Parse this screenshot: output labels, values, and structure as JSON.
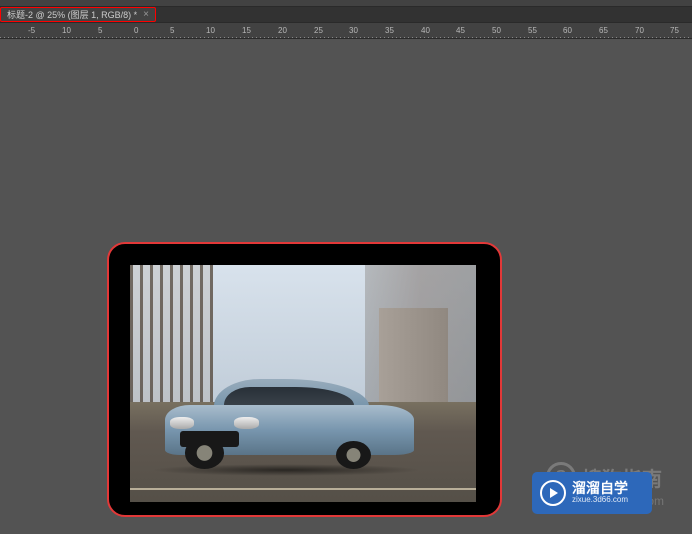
{
  "tab": {
    "title": "标题-2 @ 25% (图层 1, RGB/8) *",
    "close": "×"
  },
  "ruler": {
    "ticks": [
      {
        "label": "-5",
        "pos": 28
      },
      {
        "label": "10",
        "pos": 62
      },
      {
        "label": "5",
        "pos": 98
      },
      {
        "label": "0",
        "pos": 134
      },
      {
        "label": "5",
        "pos": 170
      },
      {
        "label": "10",
        "pos": 206
      },
      {
        "label": "15",
        "pos": 242
      },
      {
        "label": "20",
        "pos": 278
      },
      {
        "label": "25",
        "pos": 314
      },
      {
        "label": "30",
        "pos": 349
      },
      {
        "label": "35",
        "pos": 385
      },
      {
        "label": "40",
        "pos": 421
      },
      {
        "label": "45",
        "pos": 456
      },
      {
        "label": "50",
        "pos": 492
      },
      {
        "label": "55",
        "pos": 528
      },
      {
        "label": "60",
        "pos": 563
      },
      {
        "label": "65",
        "pos": 599
      },
      {
        "label": "70",
        "pos": 635
      },
      {
        "label": "75",
        "pos": 670
      }
    ]
  },
  "watermark": {
    "sogou_logo": "S",
    "sogou_text": "搜狗指南",
    "sogou_url": "zhinan.sogou.com",
    "liuliu_main": "溜溜自学",
    "liuliu_sub": "zixue.3d66.com"
  }
}
